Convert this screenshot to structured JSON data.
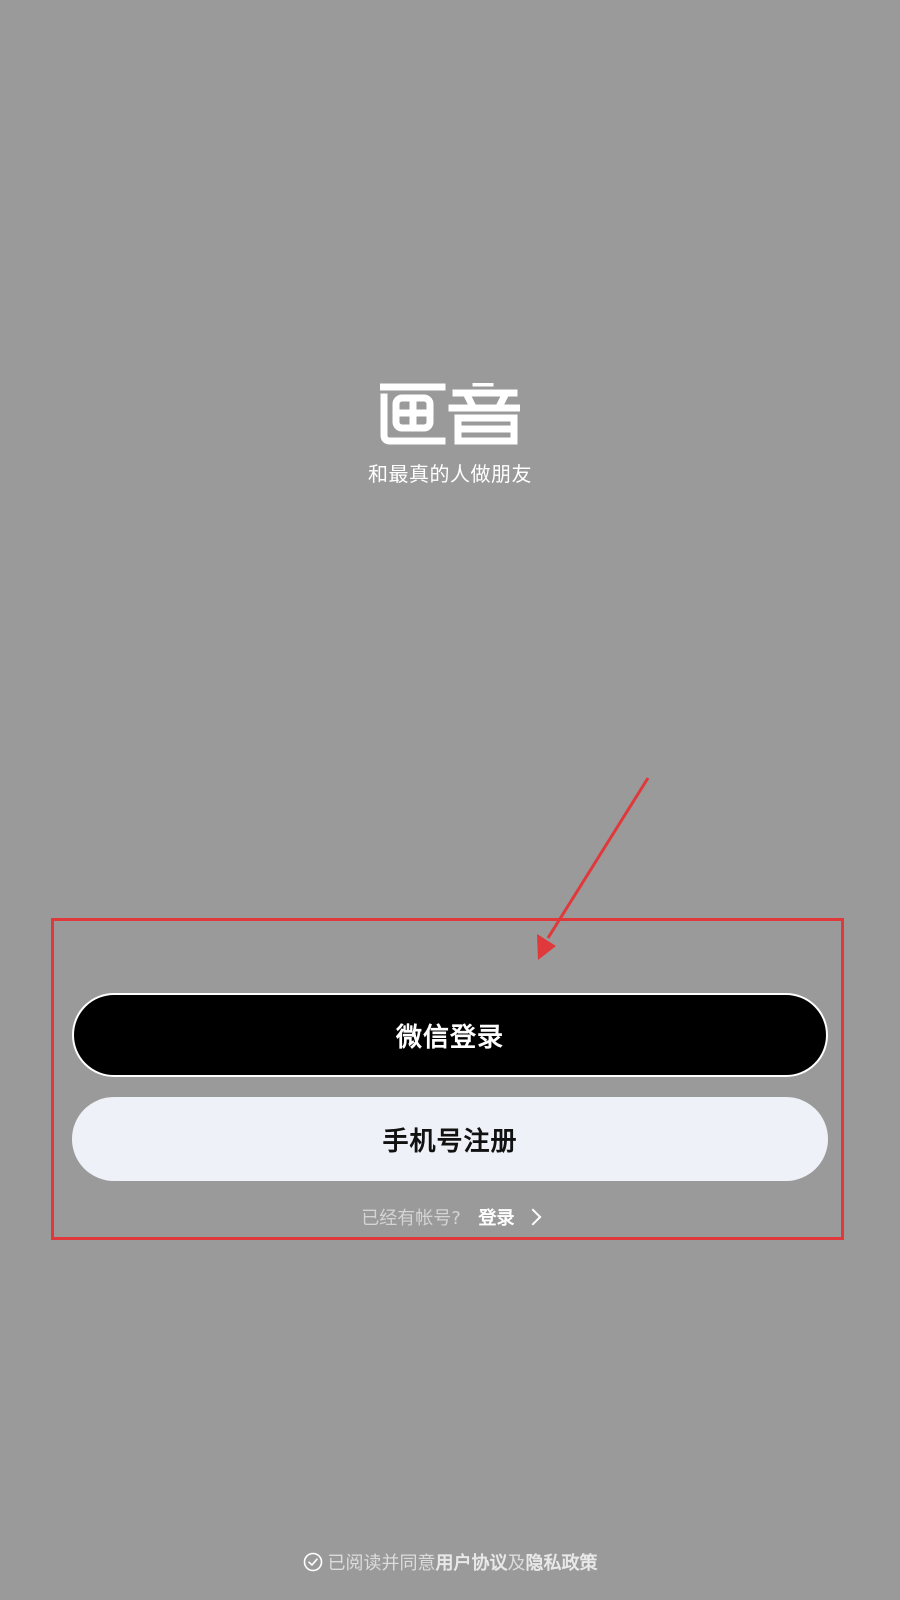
{
  "app": {
    "logo_name": "app-logo-icon",
    "slogan": "和最真的人做朋友"
  },
  "buttons": {
    "wechat_login": "微信登录",
    "phone_register": "手机号注册"
  },
  "login": {
    "prompt": "已经有帐号?",
    "link": "登录"
  },
  "agreement": {
    "prefix": "已阅读并同意",
    "user_agreement": "用户协议",
    "conjunction": "及",
    "privacy_policy": "隐私政策"
  },
  "colors": {
    "background": "#9a9a9a",
    "wechat_button": "#000000",
    "phone_button": "#eef2f8",
    "annotation": "#e0393b"
  }
}
